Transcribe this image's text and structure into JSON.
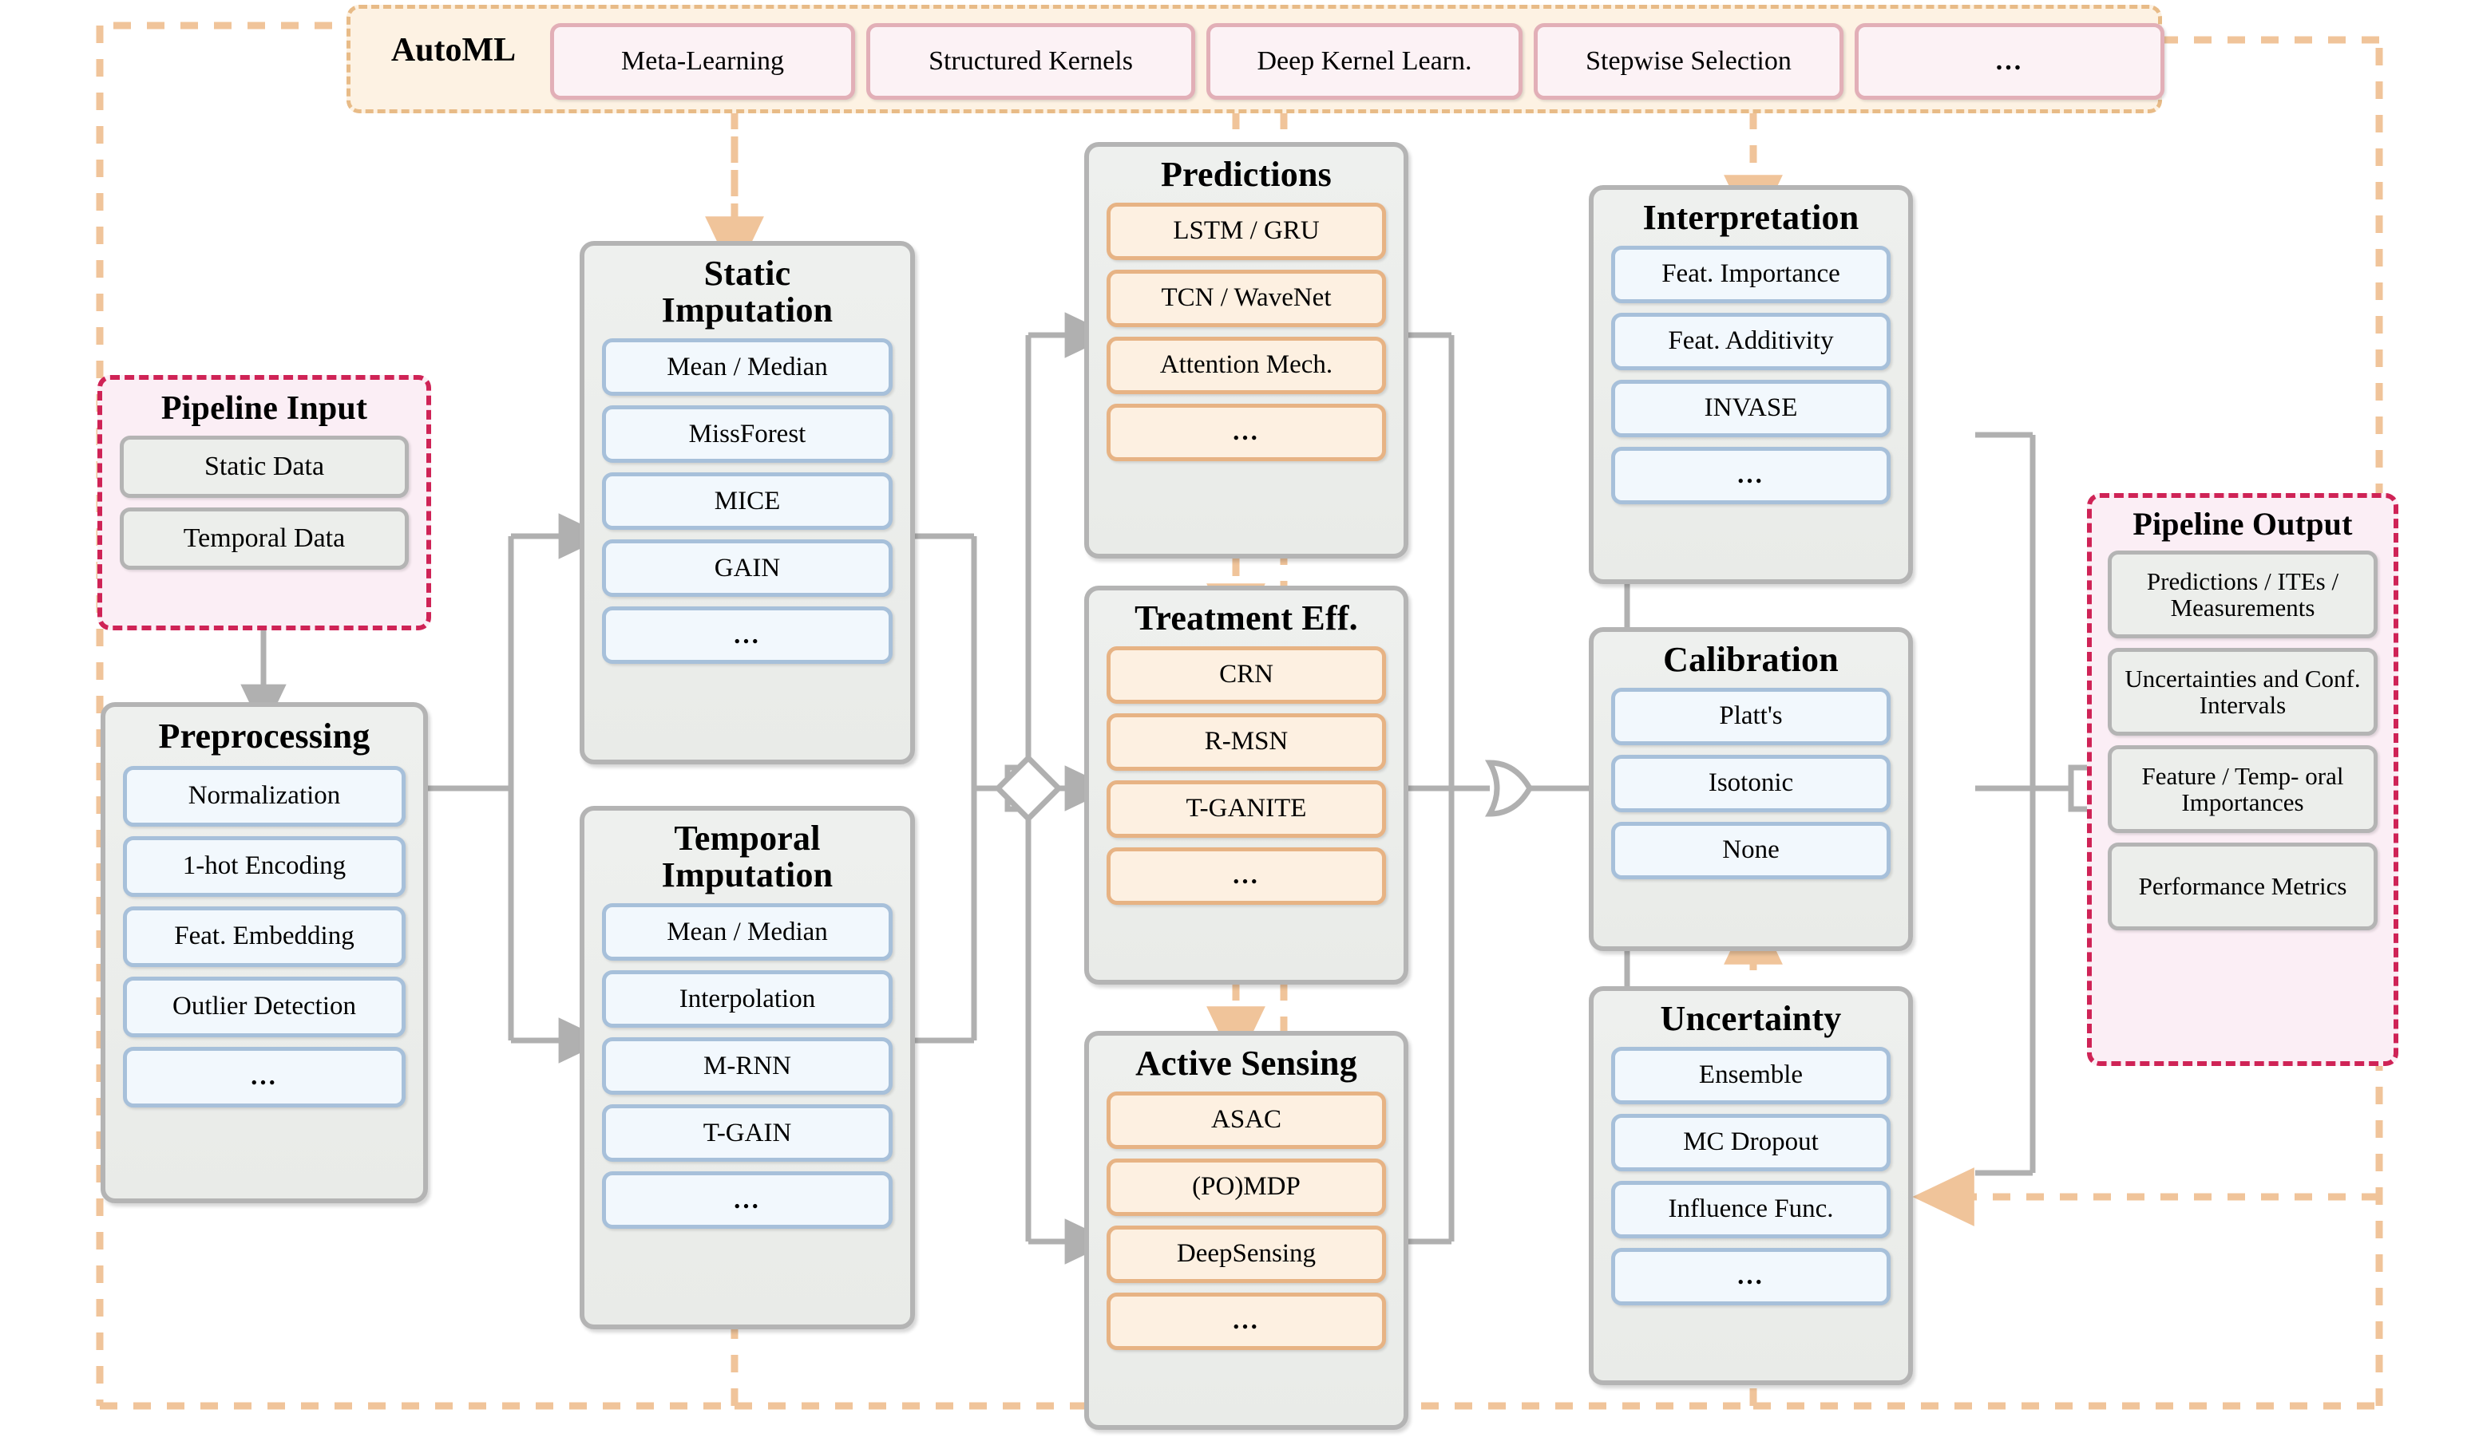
{
  "diagram": {
    "title": "AutoML clinical time-series pipeline",
    "type": "flowchart"
  },
  "automl": {
    "label": "AutoML",
    "methods": [
      {
        "label": "Meta-Learning"
      },
      {
        "label": "Structured Kernels"
      },
      {
        "label": "Deep Kernel Learn."
      },
      {
        "label": "Stepwise Selection"
      },
      {
        "label": "..."
      }
    ]
  },
  "pipeline_input": {
    "title": "Pipeline Input",
    "items": [
      {
        "label": "Static Data"
      },
      {
        "label": "Temporal Data"
      }
    ]
  },
  "preprocessing": {
    "title": "Preprocessing",
    "items": [
      {
        "label": "Normalization"
      },
      {
        "label": "1-hot Encoding"
      },
      {
        "label": "Feat. Embedding"
      },
      {
        "label": "Outlier Detection"
      },
      {
        "label": "..."
      }
    ]
  },
  "static_imputation": {
    "title_line1": "Static",
    "title_line2": "Imputation",
    "items": [
      {
        "label": "Mean / Median"
      },
      {
        "label": "MissForest"
      },
      {
        "label": "MICE"
      },
      {
        "label": "GAIN"
      },
      {
        "label": "..."
      }
    ]
  },
  "temporal_imputation": {
    "title_line1": "Temporal",
    "title_line2": "Imputation",
    "items": [
      {
        "label": "Mean / Median"
      },
      {
        "label": "Interpolation"
      },
      {
        "label": "M-RNN"
      },
      {
        "label": "T-GAIN"
      },
      {
        "label": "..."
      }
    ]
  },
  "predictions": {
    "title": "Predictions",
    "items": [
      {
        "label": "LSTM / GRU"
      },
      {
        "label": "TCN / WaveNet"
      },
      {
        "label": "Attention Mech."
      },
      {
        "label": "..."
      }
    ]
  },
  "treatment_eff": {
    "title": "Treatment Eff.",
    "items": [
      {
        "label": "CRN"
      },
      {
        "label": "R-MSN"
      },
      {
        "label": "T-GANITE"
      },
      {
        "label": "..."
      }
    ]
  },
  "active_sensing": {
    "title": "Active Sensing",
    "items": [
      {
        "label": "ASAC"
      },
      {
        "label": "(PO)MDP"
      },
      {
        "label": "DeepSensing"
      },
      {
        "label": "..."
      }
    ]
  },
  "interpretation": {
    "title": "Interpretation",
    "items": [
      {
        "label": "Feat. Importance"
      },
      {
        "label": "Feat. Additivity"
      },
      {
        "label": "INVASE"
      },
      {
        "label": "..."
      }
    ]
  },
  "calibration": {
    "title": "Calibration",
    "items": [
      {
        "label": "Platt's"
      },
      {
        "label": "Isotonic"
      },
      {
        "label": "None"
      }
    ]
  },
  "uncertainty": {
    "title": "Uncertainty",
    "items": [
      {
        "label": "Ensemble"
      },
      {
        "label": "MC Dropout"
      },
      {
        "label": "Influence Func."
      },
      {
        "label": "..."
      }
    ]
  },
  "pipeline_output": {
    "title": "Pipeline Output",
    "items": [
      {
        "label": "Predictions / ITEs / Measurements"
      },
      {
        "label": "Uncertainties and Conf. Intervals"
      },
      {
        "label": "Feature / Temp- oral Importances"
      },
      {
        "label": "Performance Metrics"
      }
    ]
  },
  "colors": {
    "automl_fill": "#fdf2e3",
    "automl_border": "#e8bb87",
    "pink_fill": "#fbeef5",
    "pink_border": "#cf2356",
    "panel_fill": "#eef0ee",
    "panel_border": "#b4b4b4",
    "item_blue_fill": "#f2f8fd",
    "item_blue_border": "#a7c0da",
    "item_orange_fill": "#fdf0e1",
    "item_orange_border": "#e7b384",
    "connector_grey": "#b0b0b0",
    "connector_dashed_orange": "#f0c49a"
  }
}
